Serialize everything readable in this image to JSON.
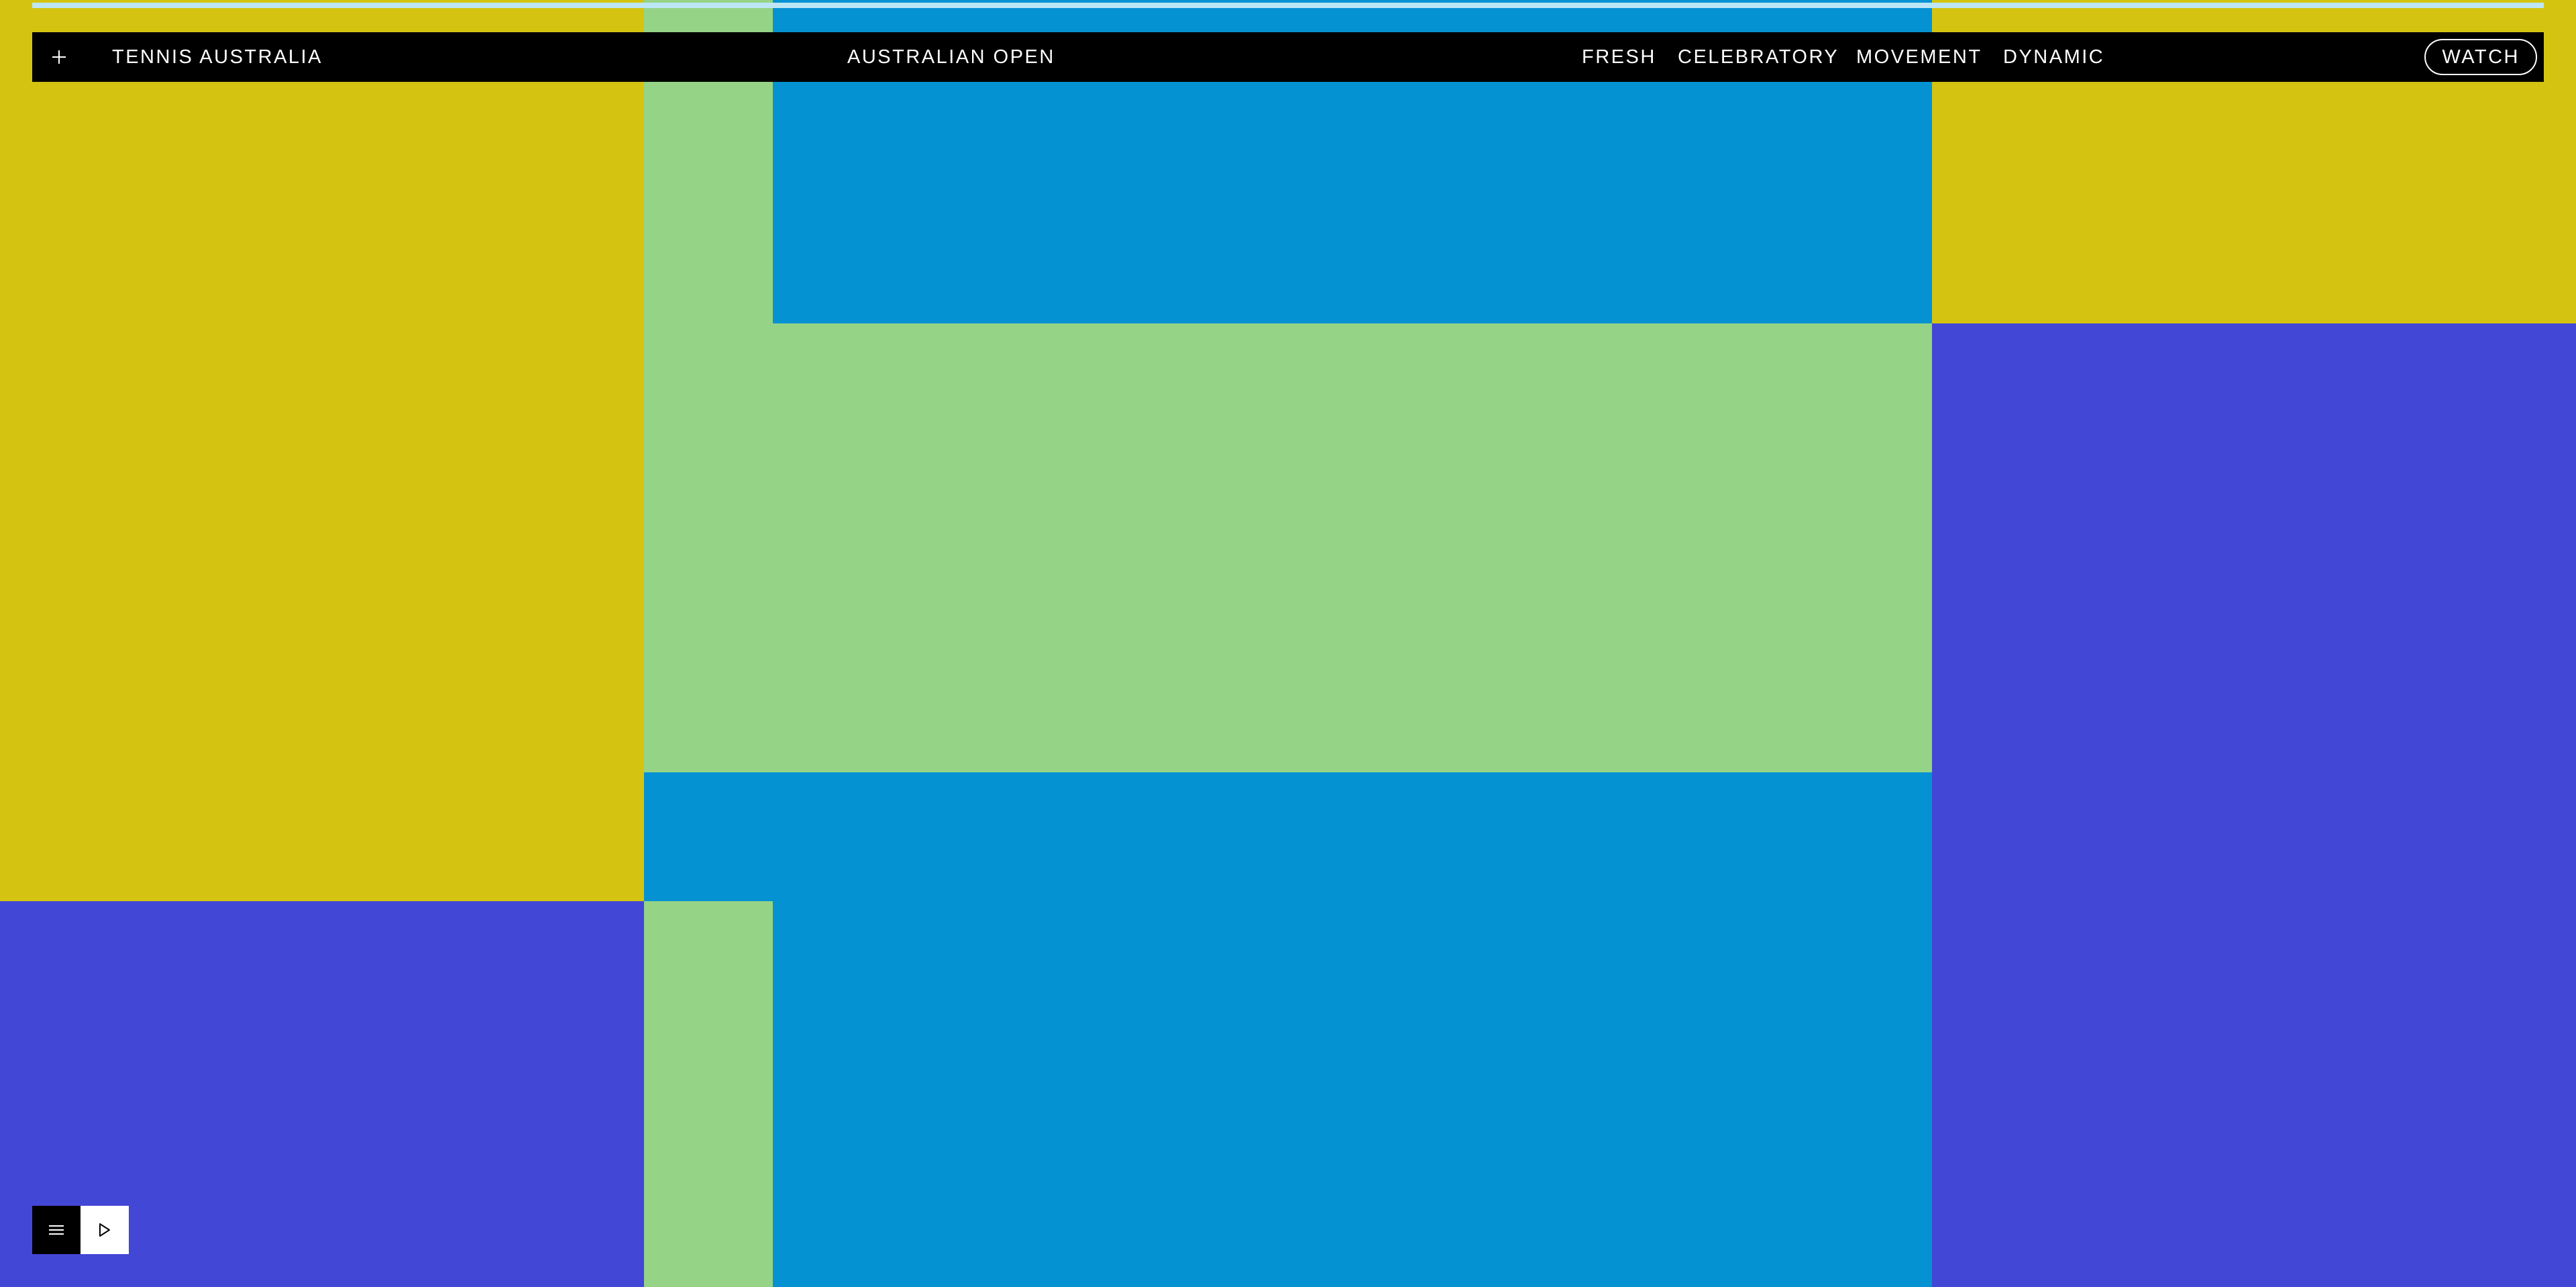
{
  "colors": {
    "yellow": "#d4c411",
    "green": "#95d486",
    "blue": "#0592d3",
    "purple": "#4347d6",
    "navbar": "#000000",
    "progress": "#bde6f5"
  },
  "progress": {
    "value_percent": 100
  },
  "nav": {
    "menu_icon": "plus-icon",
    "brand": "TENNIS AUSTRALIA",
    "event": "AUSTRALIAN OPEN",
    "links": [
      "FRESH",
      "CELEBRATORY",
      "MOVEMENT",
      "DYNAMIC"
    ],
    "watch_label": "WATCH"
  },
  "controls": {
    "menu_icon": "hamburger-icon",
    "play_icon": "play-icon"
  }
}
